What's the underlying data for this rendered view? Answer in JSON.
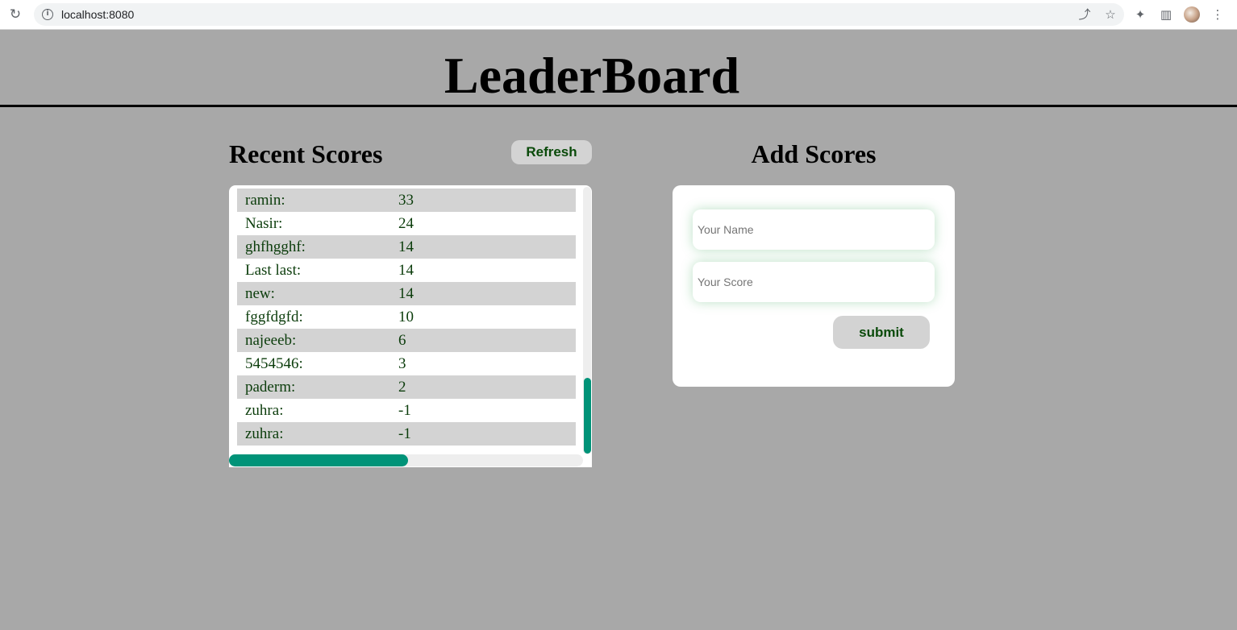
{
  "browser": {
    "url": "localhost:8080"
  },
  "page": {
    "title": "LeaderBoard"
  },
  "recent_scores": {
    "heading": "Recent Scores",
    "refresh_label": "Refresh",
    "entries": [
      {
        "name": "ramin:",
        "score": "33"
      },
      {
        "name": "Nasir:",
        "score": "24"
      },
      {
        "name": "ghfhgghf:",
        "score": "14"
      },
      {
        "name": "Last last:",
        "score": "14"
      },
      {
        "name": "new:",
        "score": "14"
      },
      {
        "name": "fggfdgfd:",
        "score": "10"
      },
      {
        "name": "najeeeb:",
        "score": "6"
      },
      {
        "name": "5454546:",
        "score": "3"
      },
      {
        "name": "paderm:",
        "score": "2"
      },
      {
        "name": "zuhra:",
        "score": "-1"
      },
      {
        "name": "zuhra:",
        "score": "-1"
      }
    ]
  },
  "add_scores": {
    "heading": "Add Scores",
    "name_placeholder": "Your Name",
    "score_placeholder": "Your Score",
    "name_value": "",
    "score_value": "",
    "submit_label": "submit"
  },
  "colors": {
    "page_background": "#a8a8a8",
    "scrollbar_accent": "#009378",
    "button_text": "#0a4a0a",
    "row_stripe": "#d3d3d3"
  },
  "icons": {
    "reload": "reload-icon",
    "site_info": "info-icon",
    "share": "share-icon",
    "bookmark": "star-icon",
    "extensions": "puzzle-icon",
    "side_panel": "side-panel-icon",
    "profile": "avatar",
    "menu": "kebab-menu-icon"
  }
}
